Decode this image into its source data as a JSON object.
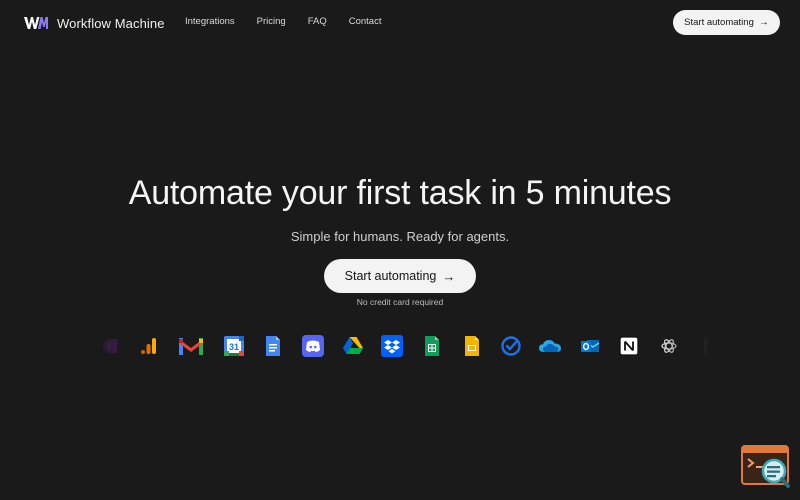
{
  "brand": {
    "name": "Workflow Machine",
    "logo_text": "WM",
    "logo_color": "#ffffff",
    "logo_accent": "#8b7cf6"
  },
  "nav": {
    "links": [
      "Integrations",
      "Pricing",
      "FAQ",
      "Contact"
    ],
    "cta_label": "Start automating"
  },
  "hero": {
    "title": "Automate your first task in 5 minutes",
    "subtitle": "Simple for humans. Ready for agents.",
    "cta_label": "Start automating",
    "note": "No credit card required"
  },
  "integrations": [
    "onenote-icon",
    "google-analytics-icon",
    "gmail-icon",
    "google-calendar-icon",
    "google-docs-icon",
    "discord-icon",
    "google-drive-icon",
    "dropbox-icon",
    "google-sheets-icon",
    "google-slides-icon",
    "todo-icon",
    "onedrive-icon",
    "outlook-icon",
    "notion-icon",
    "openai-icon",
    "partial-icon"
  ],
  "calendar_day": "31",
  "colors": {
    "background": "#1b1a1a",
    "button_bg": "#f3f3f3",
    "button_text": "#141414",
    "widget_accent": "#e07a3a"
  }
}
